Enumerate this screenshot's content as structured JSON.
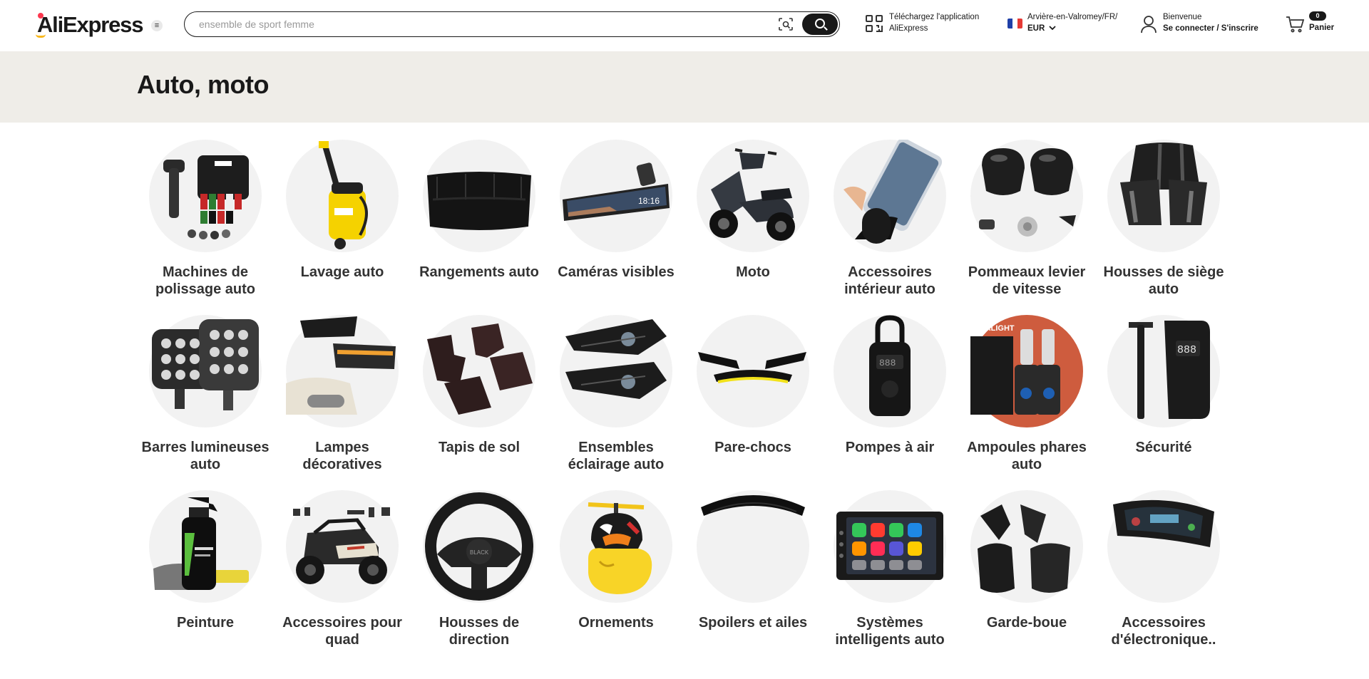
{
  "header": {
    "logo_text": "AliExpress",
    "menu_icon": "hamburger-icon",
    "search": {
      "placeholder": "ensemble de sport femme",
      "camera_icon": "camera-search-icon",
      "submit_icon": "search-icon"
    },
    "app": {
      "line1": "Téléchargez l'application",
      "line2": "AliExpress",
      "icon": "qr-code-icon"
    },
    "locale": {
      "line1": "Arvière-en-Valromey/FR/",
      "currency": "EUR",
      "flag": "france-flag-icon"
    },
    "account": {
      "line1": "Bienvenue",
      "line2": "Se connecter / S'inscrire",
      "icon": "user-icon"
    },
    "cart": {
      "count": "0",
      "label": "Panier",
      "icon": "cart-icon"
    }
  },
  "banner": {
    "title": "Auto, moto"
  },
  "categories": [
    {
      "label": "Machines de polissage auto",
      "image": "polishing-machine-kit"
    },
    {
      "label": "Lavage auto",
      "image": "pressure-washer"
    },
    {
      "label": "Rangements auto",
      "image": "seat-organizer"
    },
    {
      "label": "Caméras visibles",
      "image": "mirror-dashcam"
    },
    {
      "label": "Moto",
      "image": "scooter"
    },
    {
      "label": "Accessoires intérieur auto",
      "image": "phone-holder"
    },
    {
      "label": "Pommeaux levier de vitesse",
      "image": "gear-knobs"
    },
    {
      "label": "Housses de siège auto",
      "image": "seat-covers"
    },
    {
      "label": "Barres lumineuses auto",
      "image": "led-work-lights"
    },
    {
      "label": "Lampes décoratives",
      "image": "headlight-drl"
    },
    {
      "label": "Tapis de sol",
      "image": "floor-mats"
    },
    {
      "label": "Ensembles éclairage auto",
      "image": "headlight-assembly"
    },
    {
      "label": "Pare-chocs",
      "image": "front-lip-splitter"
    },
    {
      "label": "Pompes à air",
      "image": "portable-air-pump"
    },
    {
      "label": "Ampoules phares auto",
      "image": "led-bulbs"
    },
    {
      "label": "Sécurité",
      "image": "tire-inflator"
    },
    {
      "label": "Peinture",
      "image": "spray-bottle"
    },
    {
      "label": "Accessoires pour quad",
      "image": "utv-buggy"
    },
    {
      "label": "Housses de direction",
      "image": "steering-wheel-cover"
    },
    {
      "label": "Ornements",
      "image": "helmet-duck"
    },
    {
      "label": "Spoilers et ailes",
      "image": "rear-spoiler"
    },
    {
      "label": "Systèmes intelligents auto",
      "image": "car-multimedia-screen"
    },
    {
      "label": "Garde-boue",
      "image": "mud-flaps"
    },
    {
      "label": "Accessoires d'électronique..",
      "image": "digital-dashboard"
    }
  ]
}
